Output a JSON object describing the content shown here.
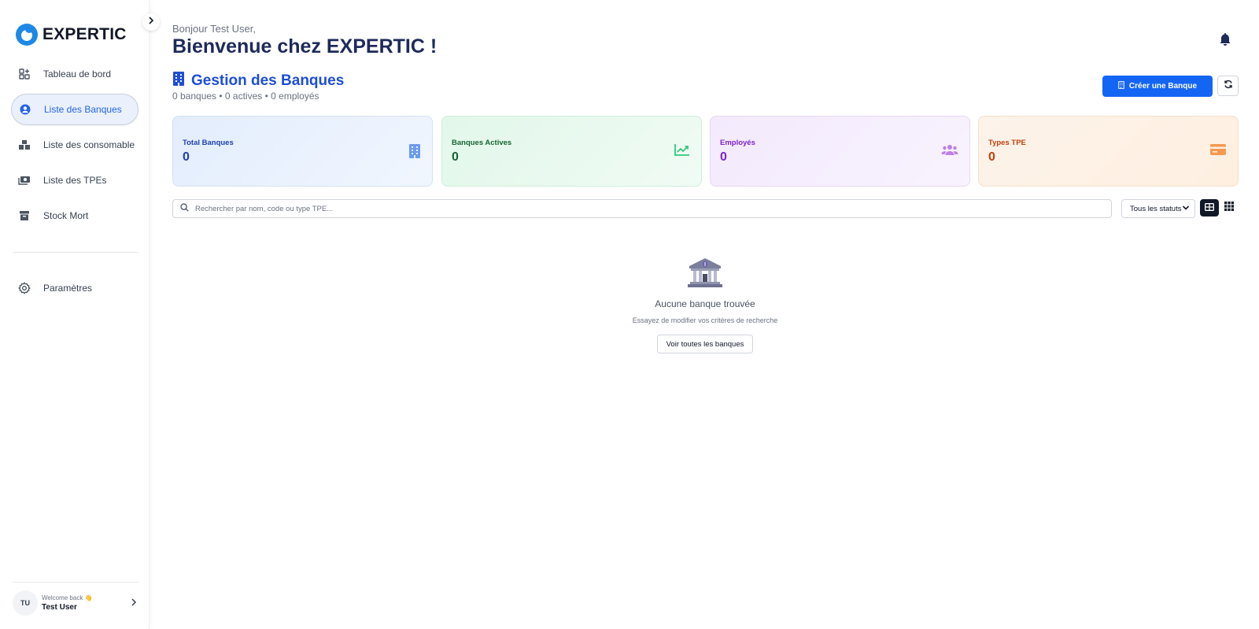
{
  "app": {
    "logo_text": "EXPERTIC"
  },
  "sidebar": {
    "items": [
      {
        "label": "Tableau de bord",
        "icon": "dashboard-grid-icon",
        "active": false
      },
      {
        "label": "Liste des Banques",
        "icon": "user-circle-icon",
        "active": true
      },
      {
        "label": "Liste des consomable",
        "icon": "boxes-icon",
        "active": false
      },
      {
        "label": "Liste des TPEs",
        "icon": "money-bill-icon",
        "active": false
      },
      {
        "label": "Stock Mort",
        "icon": "archive-box-icon",
        "active": false
      }
    ],
    "settings_label": "Paramètres",
    "user": {
      "initials": "TU",
      "welcome": "Welcome back 👋",
      "name": "Test User"
    }
  },
  "header": {
    "greeting": "Bonjour Test User,",
    "welcome": "Bienvenue chez EXPERTIC !"
  },
  "section": {
    "title": "Gestion des Banques",
    "subtitle": "0 banques • 0 actives • 0 employés",
    "create_label": "Créer une Banque"
  },
  "stats": [
    {
      "label": "Total Banques",
      "value": "0",
      "icon": "building-icon",
      "color": "#1e40af"
    },
    {
      "label": "Banques Actives",
      "value": "0",
      "icon": "chart-line-icon",
      "color": "#166534"
    },
    {
      "label": "Employés",
      "value": "0",
      "icon": "users-icon",
      "color": "#7e22ce"
    },
    {
      "label": "Types TPE",
      "value": "0",
      "icon": "credit-card-icon",
      "color": "#c2410c"
    }
  ],
  "filters": {
    "search_placeholder": "Rechercher par nom, code ou type TPE...",
    "status_selected": "Tous les statuts"
  },
  "empty_state": {
    "title": "Aucune banque trouvée",
    "subtitle": "Essayez de modifier vos critères de recherche",
    "button_label": "Voir toutes les banques"
  },
  "colors": {
    "primary": "#1565f5",
    "heading": "#1e2a5a",
    "accent": "#1d4ed8"
  }
}
